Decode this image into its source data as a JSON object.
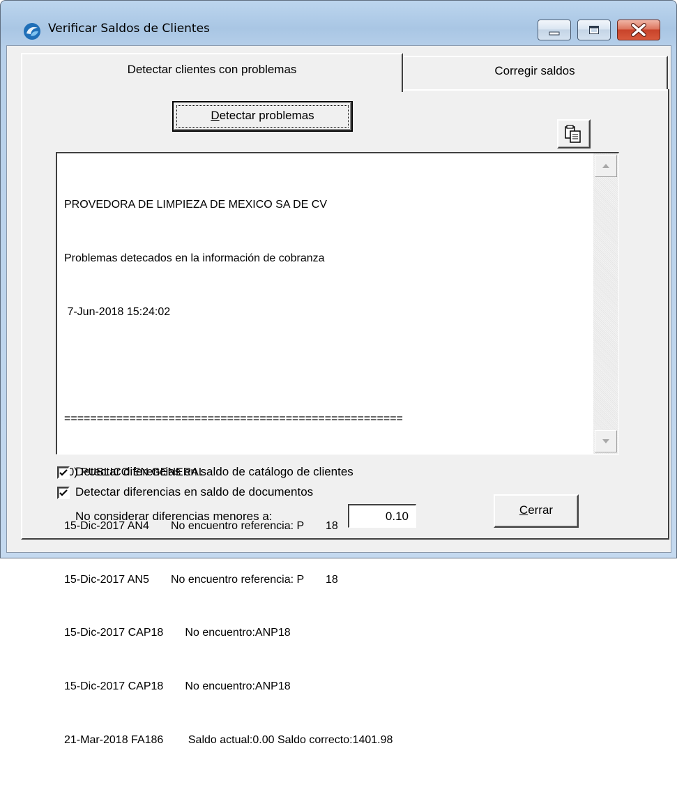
{
  "window": {
    "title": "Verificar Saldos de Clientes"
  },
  "tabs": [
    {
      "label": "Detectar clientes con problemas",
      "active": true
    },
    {
      "label": "Corregir saldos",
      "active": false
    }
  ],
  "detect_button": {
    "mnemonic": "D",
    "rest": "etectar problemas"
  },
  "copy_button": {
    "icon": "copy-icon"
  },
  "output_lines": [
    "PROVEDORA DE LIMPIEZA DE MEXICO SA DE CV",
    "Problemas detecados en la información de cobranza",
    " 7-Jun-2018 15:24:02",
    "",
    "====================================================",
    "(0) PUBLICO EN GENERAL",
    "15-Dic-2017 AN4       No encuentro referencia: P       18",
    "15-Dic-2017 AN5       No encuentro referencia: P       18",
    "15-Dic-2017 CAP18       No encuentro:ANP18",
    "15-Dic-2017 CAP18       No encuentro:ANP18",
    "21-Mar-2018 FA186        Saldo actual:0.00 Saldo correcto:1401.98"
  ],
  "options": {
    "check_catalog": {
      "label": "Detectar diferencias en saldo de catálogo de clientes",
      "checked": true
    },
    "check_documents": {
      "label": "Detectar diferencias en saldo de documentos",
      "checked": true
    },
    "threshold_label": "No considerar diferencias menores a:",
    "threshold_value": "0.10"
  },
  "close_button": {
    "mnemonic": "C",
    "rest": "errar"
  }
}
